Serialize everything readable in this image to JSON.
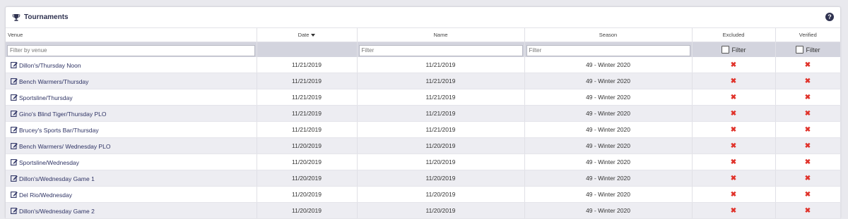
{
  "panel": {
    "title": "Tournaments",
    "help_label": "?"
  },
  "columns": {
    "venue": "Venue",
    "date": "Date",
    "name": "Name",
    "season": "Season",
    "excluded": "Excluded",
    "verified": "Verified"
  },
  "filters": {
    "venue_placeholder": "Filter by venue",
    "name_placeholder": "Filter",
    "season_placeholder": "Filter",
    "excluded_label": "Filter",
    "verified_label": "Filter"
  },
  "colors": {
    "accent": "#2f3250",
    "x_mark": "#e0322a",
    "filter_bg": "#d3d4de",
    "row_alt": "#ededf2"
  },
  "rows": [
    {
      "venue": "Dillon's/Thursday Noon",
      "date": "11/21/2019",
      "name": "11/21/2019",
      "season": "49 - Winter 2020",
      "excluded": "✖",
      "verified": "✖"
    },
    {
      "venue": "Bench Warmers/Thursday",
      "date": "11/21/2019",
      "name": "11/21/2019",
      "season": "49 - Winter 2020",
      "excluded": "✖",
      "verified": "✖"
    },
    {
      "venue": "Sportsline/Thursday",
      "date": "11/21/2019",
      "name": "11/21/2019",
      "season": "49 - Winter 2020",
      "excluded": "✖",
      "verified": "✖"
    },
    {
      "venue": "Gino's Blind Tiger/Thursday PLO",
      "date": "11/21/2019",
      "name": "11/21/2019",
      "season": "49 - Winter 2020",
      "excluded": "✖",
      "verified": "✖"
    },
    {
      "venue": "Brucey's Sports Bar/Thursday",
      "date": "11/21/2019",
      "name": "11/21/2019",
      "season": "49 - Winter 2020",
      "excluded": "✖",
      "verified": "✖"
    },
    {
      "venue": "Bench Warmers/ Wednesday PLO",
      "date": "11/20/2019",
      "name": "11/20/2019",
      "season": "49 - Winter 2020",
      "excluded": "✖",
      "verified": "✖"
    },
    {
      "venue": "Sportsline/Wednesday",
      "date": "11/20/2019",
      "name": "11/20/2019",
      "season": "49 - Winter 2020",
      "excluded": "✖",
      "verified": "✖"
    },
    {
      "venue": "Dillon's/Wednesday Game 1",
      "date": "11/20/2019",
      "name": "11/20/2019",
      "season": "49 - Winter 2020",
      "excluded": "✖",
      "verified": "✖"
    },
    {
      "venue": "Del Rio/Wednesday",
      "date": "11/20/2019",
      "name": "11/20/2019",
      "season": "49 - Winter 2020",
      "excluded": "✖",
      "verified": "✖"
    },
    {
      "venue": "Dillon's/Wednesday Game 2",
      "date": "11/20/2019",
      "name": "11/20/2019",
      "season": "49 - Winter 2020",
      "excluded": "✖",
      "verified": "✖"
    }
  ]
}
